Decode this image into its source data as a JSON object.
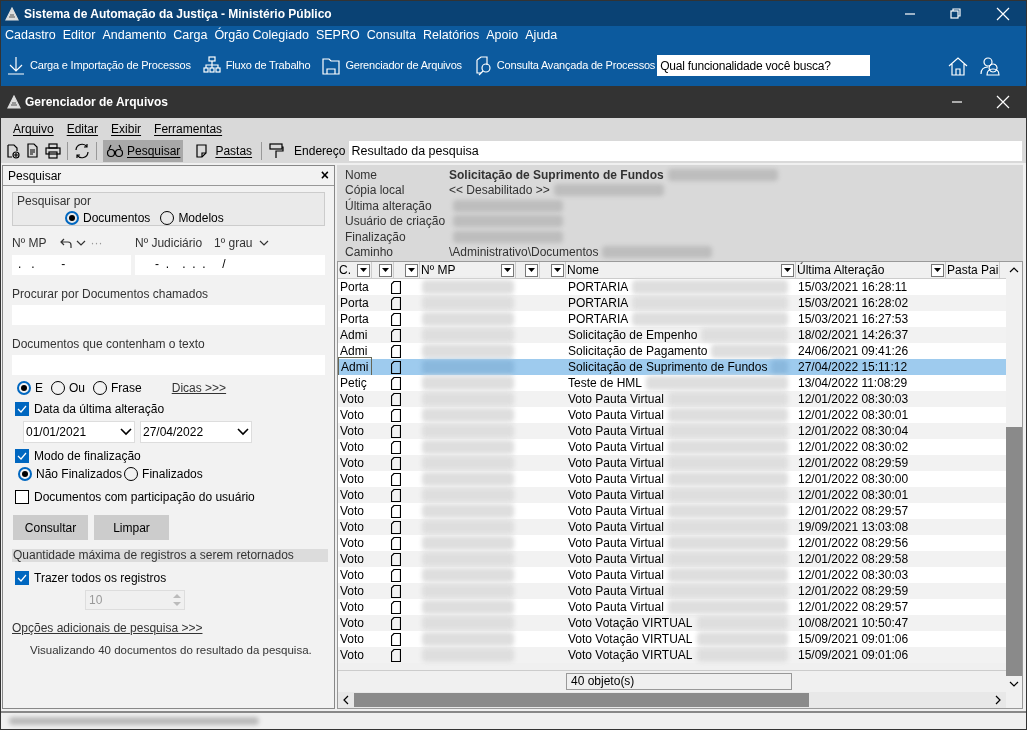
{
  "app": {
    "title": "Sistema de Automação da Justiça - Ministério Público"
  },
  "menu": [
    "Cadastro",
    "Editor",
    "Andamento",
    "Carga",
    "Órgão Colegiado",
    "SEPRO",
    "Consulta",
    "Relatórios",
    "Apoio",
    "Ajuda"
  ],
  "shortcuts": [
    {
      "kind": "download",
      "label": "Carga e Importação de Processos"
    },
    {
      "kind": "flow",
      "label": "Fluxo de Trabalho"
    },
    {
      "kind": "folder",
      "label": "Gerenciador de Arquivos"
    },
    {
      "kind": "search",
      "label": "Consulta Avançada de Processos"
    }
  ],
  "search": {
    "placeholder": "Qual funcionalidade você busca?"
  },
  "window": {
    "title": "Gerenciador de Arquivos"
  },
  "window_menu": [
    "Arquivo",
    "Editar",
    "Exibir",
    "Ferramentas"
  ],
  "toolbar": {
    "search_button": {
      "label": "Pesquisar",
      "selected": true
    },
    "folders_button": {
      "label": "Pastas",
      "selected": false
    },
    "address_label": "Endereço",
    "address": "Resultado da pesquisa"
  },
  "panel": {
    "title": "Pesquisar",
    "close": "×",
    "search_by_label": "Pesquisar por",
    "search_by": [
      {
        "label": "Documentos",
        "selected": true
      },
      {
        "label": "Modelos",
        "selected": false
      }
    ],
    "mp_label": "Nº MP",
    "mp_value": ".   .        -",
    "more": "···",
    "judicial_label": "Nº Judiciário",
    "degree": "1º grau",
    "judicial_value": "-  .    .  .  .     /",
    "names_label": "Procurar por Documentos chamados",
    "text_label": "Documentos que contenham o texto",
    "match": [
      {
        "label": "E",
        "selected": true
      },
      {
        "label": "Ou",
        "selected": false
      },
      {
        "label": "Frase",
        "selected": false
      }
    ],
    "tips_link": "Dicas >>>",
    "date_filter": {
      "label": "Data da última alteração",
      "checked": true,
      "from": "01/01/2021",
      "to": "27/04/2022"
    },
    "final_filter": {
      "label": "Modo de finalização",
      "checked": true
    },
    "final_modes": [
      {
        "label": "Não Finalizados",
        "selected": true
      },
      {
        "label": "Finalizados",
        "selected": false
      }
    ],
    "participation": {
      "label": "Documentos com participação do usuário",
      "checked": false
    },
    "buttons": [
      "Consultar",
      "Limpar"
    ],
    "max_section": "Quantidade máxima de registros a serem retornados",
    "all_records": {
      "label": "Trazer todos os registros",
      "checked": true
    },
    "max_value": "10",
    "more_options": "Opções adicionais de pesquisa >>>",
    "summary": "Visualizando 40 documentos do resultado da pesquisa."
  },
  "details": [
    {
      "label": "Nome",
      "value": "Solicitação de Suprimento de Fundos",
      "bold": true
    },
    {
      "label": "Cópia local",
      "value": "<< Desabilitado >>",
      "bold": false
    },
    {
      "label": "Última alteração"
    },
    {
      "label": "Usuário de criação"
    },
    {
      "label": "Finalização"
    },
    {
      "label": "Caminho",
      "value": "\\Administrativo\\Documentos",
      "bold": false
    }
  ],
  "table": {
    "columns": [
      "C.",
      "",
      "",
      "Nº MP",
      "",
      "",
      "Nome",
      "Última Alteração",
      "Pasta Pai"
    ],
    "rows": [
      {
        "type": "Porta",
        "name": "PORTARIA",
        "modified": "15/03/2021 16:28:11",
        "selected": false
      },
      {
        "type": "Porta",
        "name": "PORTARIA",
        "modified": "15/03/2021 16:28:02",
        "selected": false
      },
      {
        "type": "Porta",
        "name": "PORTARIA",
        "modified": "15/03/2021 16:27:53",
        "selected": false
      },
      {
        "type": "Admi",
        "name": "Solicitação de Empenho",
        "modified": "18/02/2021 14:26:37",
        "selected": false
      },
      {
        "type": "Admi",
        "name": "Solicitação de Pagamento",
        "modified": "24/06/2021 09:41:26",
        "selected": false
      },
      {
        "type": "Admi",
        "name": "Solicitação de Suprimento de Fundos",
        "modified": "27/04/2022 15:11:12",
        "selected": true
      },
      {
        "type": "Petiç",
        "name": "Teste de HML",
        "modified": "13/04/2022 11:08:29",
        "selected": false
      },
      {
        "type": "Voto",
        "name": "Voto Pauta Virtual",
        "modified": "12/01/2022 08:30:03",
        "selected": false
      },
      {
        "type": "Voto",
        "name": "Voto Pauta Virtual",
        "modified": "12/01/2022 08:30:01",
        "selected": false
      },
      {
        "type": "Voto",
        "name": "Voto Pauta Virtual",
        "modified": "12/01/2022 08:30:04",
        "selected": false
      },
      {
        "type": "Voto",
        "name": "Voto Pauta Virtual",
        "modified": "12/01/2022 08:30:02",
        "selected": false
      },
      {
        "type": "Voto",
        "name": "Voto Pauta Virtual",
        "modified": "12/01/2022 08:29:59",
        "selected": false
      },
      {
        "type": "Voto",
        "name": "Voto Pauta Virtual",
        "modified": "12/01/2022 08:30:00",
        "selected": false
      },
      {
        "type": "Voto",
        "name": "Voto Pauta Virtual",
        "modified": "12/01/2022 08:30:01",
        "selected": false
      },
      {
        "type": "Voto",
        "name": "Voto Pauta Virtual",
        "modified": "12/01/2022 08:29:57",
        "selected": false
      },
      {
        "type": "Voto",
        "name": "Voto Pauta Virtual",
        "modified": "19/09/2021 13:03:08",
        "selected": false
      },
      {
        "type": "Voto",
        "name": "Voto Pauta Virtual",
        "modified": "12/01/2022 08:29:56",
        "selected": false
      },
      {
        "type": "Voto",
        "name": "Voto Pauta Virtual",
        "modified": "12/01/2022 08:29:58",
        "selected": false
      },
      {
        "type": "Voto",
        "name": "Voto Pauta Virtual",
        "modified": "12/01/2022 08:30:03",
        "selected": false
      },
      {
        "type": "Voto",
        "name": "Voto Pauta Virtual",
        "modified": "12/01/2022 08:29:59",
        "selected": false
      },
      {
        "type": "Voto",
        "name": "Voto Pauta Virtual",
        "modified": "12/01/2022 08:29:57",
        "selected": false
      },
      {
        "type": "Voto",
        "name": "Voto Votação VIRTUAL",
        "modified": "10/08/2021 10:50:47",
        "selected": false
      },
      {
        "type": "Voto",
        "name": "Voto Votação VIRTUAL",
        "modified": "15/09/2021 09:01:06",
        "selected": false
      },
      {
        "type": "Voto",
        "name": "Voto Votação VIRTUAL",
        "modified": "15/09/2021 09:01:06",
        "selected": false
      }
    ],
    "footer": "40 objeto(s)"
  }
}
